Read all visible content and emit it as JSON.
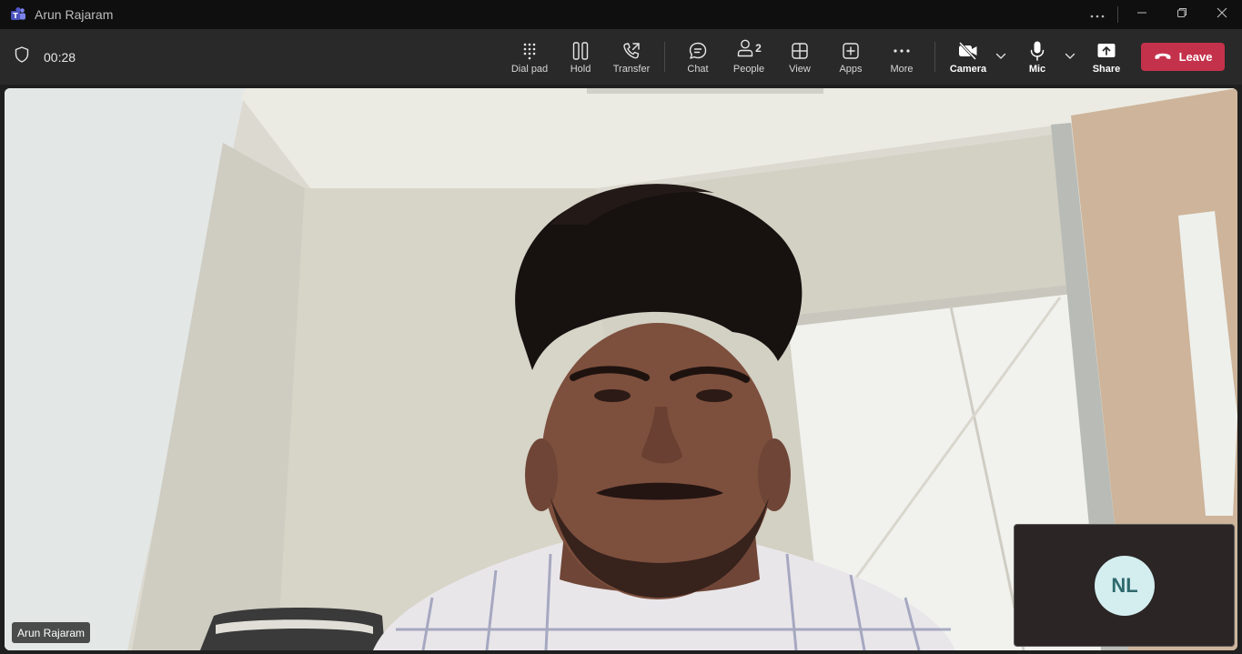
{
  "window": {
    "title": "Arun Rajaram",
    "controls": {
      "more": "more-options-icon",
      "minimize": "minimize-icon",
      "restore": "restore-icon",
      "close": "close-icon"
    }
  },
  "call": {
    "timer": "00:28",
    "security_icon": "shield-icon"
  },
  "toolbar": {
    "dial_pad": "Dial pad",
    "hold": "Hold",
    "transfer": "Transfer",
    "chat": "Chat",
    "people": "People",
    "people_count": "2",
    "view": "View",
    "apps": "Apps",
    "more": "More",
    "camera": "Camera",
    "mic": "Mic",
    "share": "Share",
    "leave": "Leave"
  },
  "participants": {
    "main": {
      "name": "Arun Rajaram"
    },
    "self": {
      "initials": "NL"
    }
  },
  "colors": {
    "leave": "#c4314b",
    "toolbar": "#292929",
    "avatar_bg": "#d4eef0",
    "avatar_fg": "#2f6a6d"
  }
}
